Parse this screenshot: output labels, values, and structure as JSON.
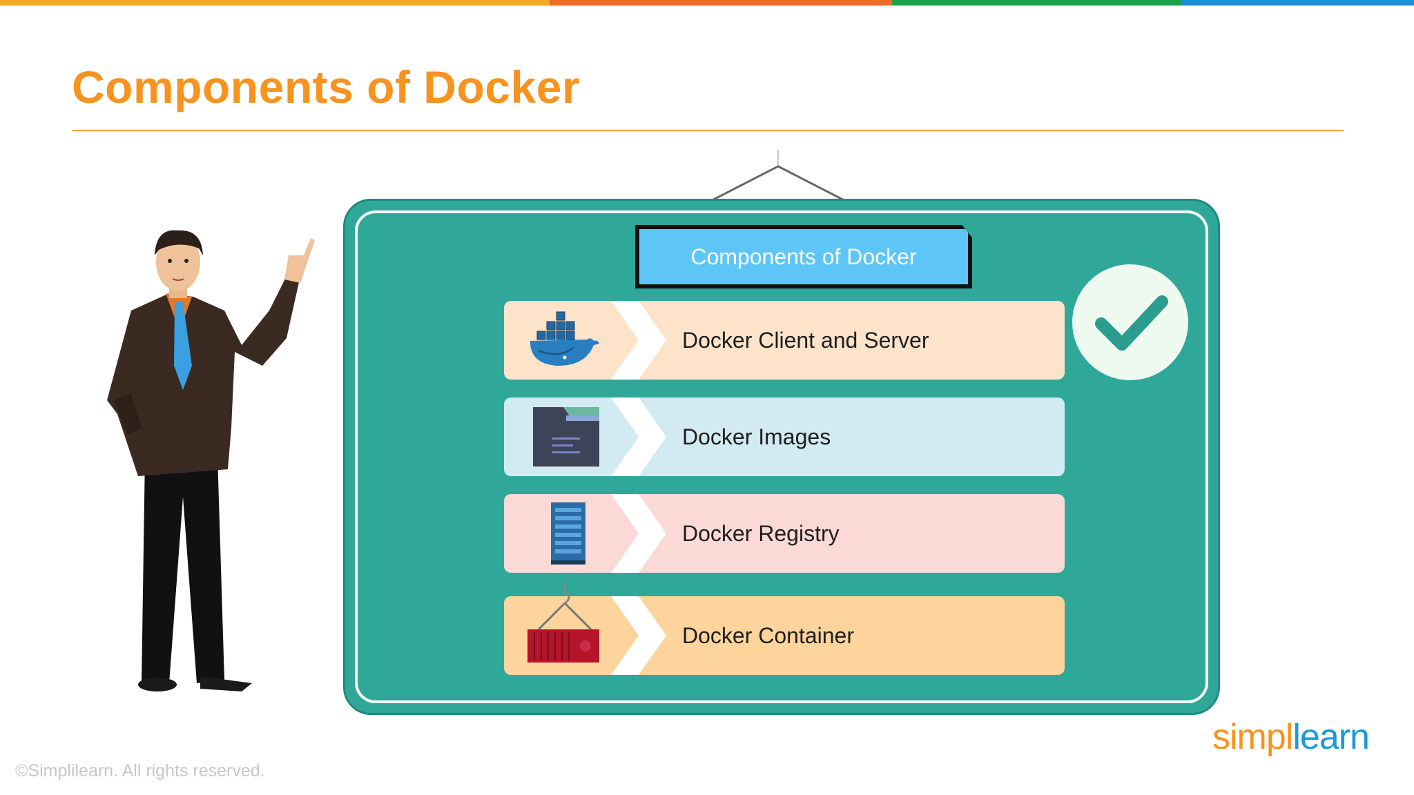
{
  "slide": {
    "title": "Components of Docker",
    "board_title": "Components of Docker",
    "items": [
      {
        "label": "Docker Client and Server",
        "icon": "docker-whale-icon",
        "color": "#fde3ca"
      },
      {
        "label": "Docker Images",
        "icon": "image-file-icon",
        "color": "#d2eaf1"
      },
      {
        "label": "Docker Registry",
        "icon": "server-rack-icon",
        "color": "#fbd9d6"
      },
      {
        "label": "Docker Container",
        "icon": "crane-container-icon",
        "color": "#fdd49b"
      }
    ],
    "check_icon": "checkmark-icon"
  },
  "footer": {
    "copyright": "©Simplilearn. All rights reserved.",
    "logo_simpl": "simpl",
    "logo_learn": "learn"
  },
  "colors": {
    "accent": "#f7931e",
    "board": "#2fa89a",
    "board_title_bg": "#5ec6f7",
    "topbar": [
      "#f7a823",
      "#f26b22",
      "#1aa34a",
      "#1a8fd6"
    ]
  }
}
